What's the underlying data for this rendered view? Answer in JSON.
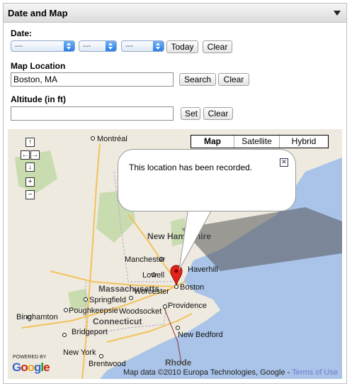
{
  "panel": {
    "title": "Date and Map"
  },
  "date": {
    "label": "Date:",
    "selects": [
      "---",
      "---",
      "---"
    ],
    "today_label": "Today",
    "clear_label": "Clear"
  },
  "location": {
    "label": "Map Location",
    "value": "Boston, MA",
    "search_label": "Search",
    "clear_label": "Clear"
  },
  "altitude": {
    "label": "Altitude (in ft)",
    "value": "",
    "set_label": "Set",
    "clear_label": "Clear"
  },
  "map": {
    "types": [
      "Map",
      "Satellite",
      "Hybrid"
    ],
    "selected_type": "Map",
    "info_message": "This location has been recorded.",
    "copyright": "Map data ©2010 Europa Technologies, Google - ",
    "terms": "Terms of Use",
    "powered_by": "POWERED BY",
    "logo": "Google",
    "cities": [
      "Montréal",
      "Manchester",
      "Lowell",
      "Haverhill",
      "Boston",
      "Springfield",
      "Worcester",
      "Woodsocket",
      "Providence",
      "Poughkeepsie",
      "Bridgeport",
      "New York",
      "Brentwood",
      "Binghamton",
      "New Bedford"
    ],
    "states": [
      "New Hampshire",
      "Massachusetts",
      "Connecticut",
      "Rhode"
    ],
    "marker": "Boston pin",
    "water_color": "#a9c4e8",
    "land_color": "#eeeadf"
  }
}
